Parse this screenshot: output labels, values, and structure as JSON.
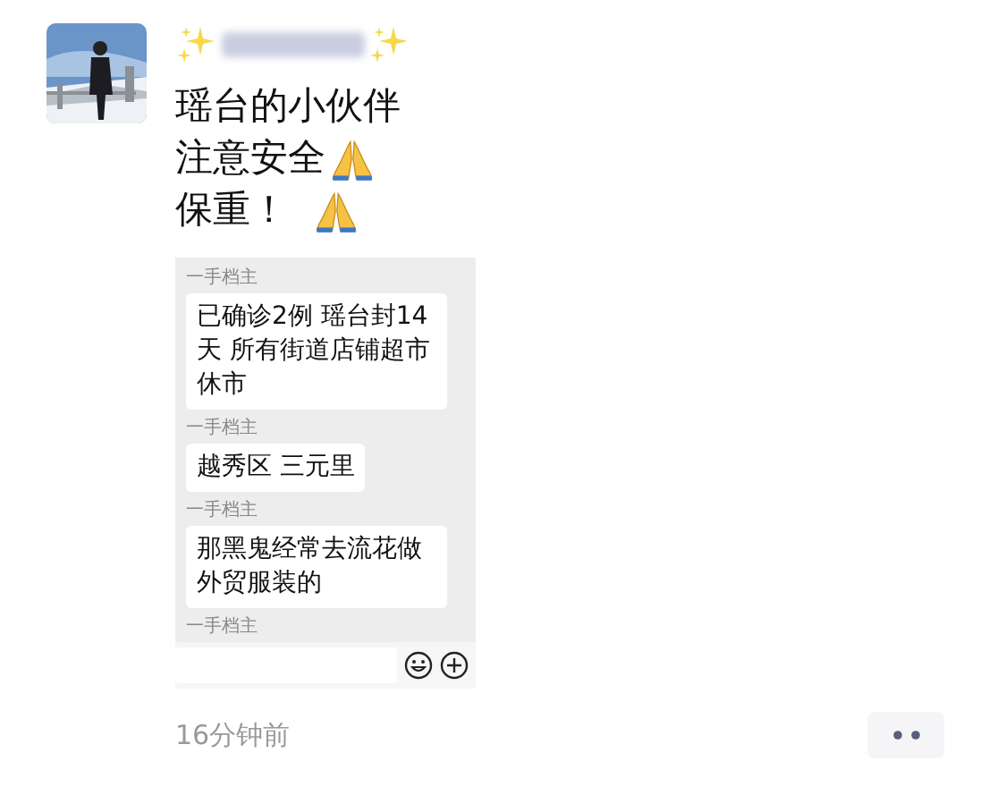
{
  "post": {
    "avatar": {
      "kind": "picture"
    },
    "lines": [
      "瑶台的小伙伴",
      "注意安全",
      "保重！"
    ],
    "screenshot": {
      "messages": [
        {
          "sender": "一手档主",
          "text": "已确诊2例 瑶台封14天 所有街道店铺超市休市"
        },
        {
          "sender": "一手档主",
          "text": "越秀区 三元里"
        },
        {
          "sender": "一手档主",
          "text": "那黑鬼经常去流花做外贸服装的"
        },
        {
          "sender": "一手档主"
        }
      ]
    },
    "time": "16分钟前"
  }
}
